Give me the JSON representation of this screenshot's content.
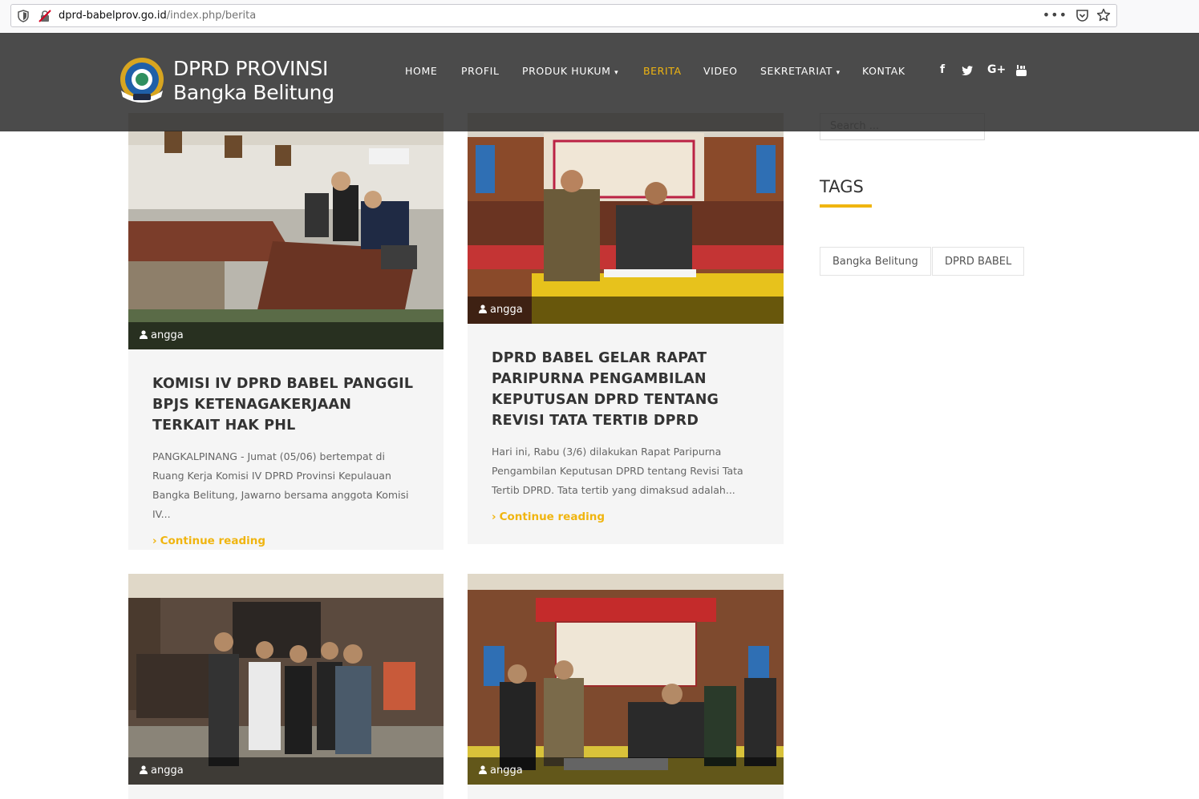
{
  "browser": {
    "url_domain": "dprd-babelprov.go.id",
    "url_path": "/index.php/berita"
  },
  "site": {
    "brand_line1": "DPRD PROVINSI",
    "brand_line2": "Bangka Belitung",
    "accent_color": "#f0b510",
    "nav": [
      {
        "label": "HOME"
      },
      {
        "label": "PROFIL"
      },
      {
        "label": "PRODUK HUKUM"
      },
      {
        "label": "BERITA",
        "active": true
      },
      {
        "label": "VIDEO"
      },
      {
        "label": "SEKRETARIAT"
      },
      {
        "label": "KONTAK"
      }
    ],
    "social_icons": [
      "facebook-icon",
      "twitter-icon",
      "google-plus-icon",
      "youtube-icon"
    ]
  },
  "posts": [
    {
      "author": "angga",
      "title": "KOMISI IV DPRD BABEL PANGGIL BPJS KETENAGAKERJAAN TERKAIT HAK PHL",
      "excerpt": "PANGKALPINANG - Jumat (05/06) bertempat di Ruang Kerja Komisi IV DPRD Provinsi Kepulauan Bangka Belitung, Jawarno bersama anggota Komisi IV...",
      "more": "Continue reading"
    },
    {
      "author": "angga",
      "title": "DPRD BABEL GELAR RAPAT PARIPURNA PENGAMBILAN KEPUTUSAN DPRD TENTANG REVISI TATA TERTIB DPRD",
      "excerpt": "Hari ini, Rabu (3/6) dilakukan Rapat Paripurna Pengambilan Keputusan DPRD tentang Revisi Tata Tertib DPRD. Tata tertib yang dimaksud adalah...",
      "more": "Continue reading"
    },
    {
      "author": "angga"
    },
    {
      "author": "angga"
    }
  ],
  "sidebar": {
    "search_placeholder": "Search ...",
    "tags_title": "TAGS",
    "tags": [
      "Bangka Belitung",
      "DPRD BABEL"
    ]
  }
}
